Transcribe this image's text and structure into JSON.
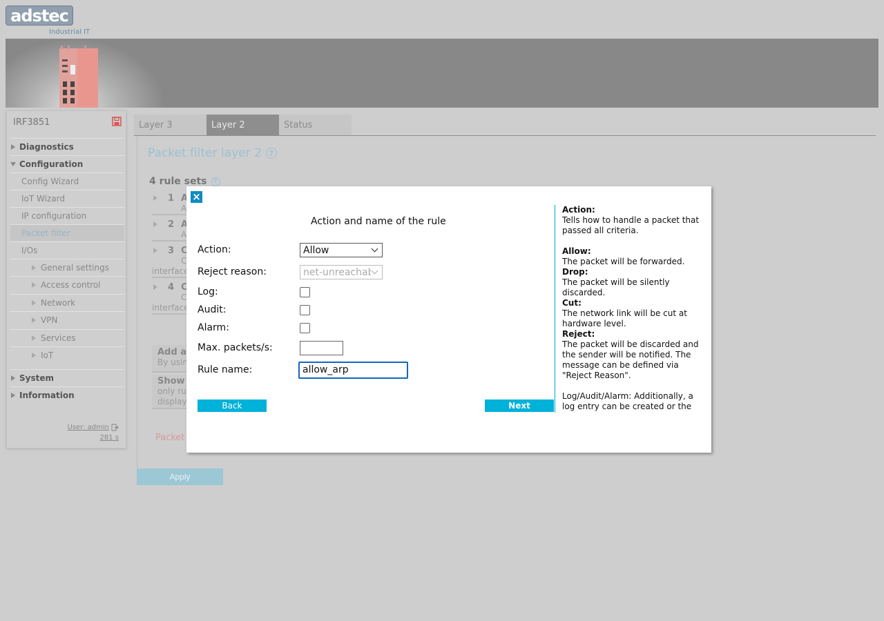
{
  "brand": {
    "logo_text": "adstec",
    "subtitle": "Industrial IT"
  },
  "sidebar": {
    "device_name": "IRF3851",
    "items": [
      {
        "label": "Diagnostics"
      },
      {
        "label": "Configuration"
      },
      {
        "label": "Config Wizard"
      },
      {
        "label": "IoT Wizard"
      },
      {
        "label": "IP configuration"
      },
      {
        "label": "Packet filter"
      },
      {
        "label": "I/Os"
      },
      {
        "label": "General settings"
      },
      {
        "label": "Access control"
      },
      {
        "label": "Network"
      },
      {
        "label": "VPN"
      },
      {
        "label": "Services"
      },
      {
        "label": "IoT"
      },
      {
        "label": "System"
      },
      {
        "label": "Information"
      }
    ],
    "user_link": "User: admin",
    "session_timer": "281 s"
  },
  "tabs": [
    {
      "label": "Layer 3"
    },
    {
      "label": "Layer 2"
    },
    {
      "label": "Status"
    }
  ],
  "main": {
    "title": "Packet filter layer 2",
    "rule_sets_label": "4 rule sets",
    "rules": [
      {
        "num": "1",
        "name": "A",
        "sub": "A",
        "iface": ""
      },
      {
        "num": "2",
        "name": "A",
        "sub": "A",
        "iface": ""
      },
      {
        "num": "3",
        "name": "C",
        "sub": "C",
        "iface": "interface"
      },
      {
        "num": "4",
        "name": "C",
        "sub": "C",
        "iface": "interface"
      }
    ],
    "add_box": {
      "title": "Add a",
      "sub": "By usin"
    },
    "show_box": {
      "title": "Show",
      "line1": "only ru",
      "line2": "display"
    },
    "status_text": "Packet",
    "apply_label": "Apply"
  },
  "modal": {
    "close_glyph": "×",
    "title": "Action and name of the rule",
    "labels": {
      "action": "Action:",
      "reject_reason": "Reject reason:",
      "log": "Log:",
      "audit": "Audit:",
      "alarm": "Alarm:",
      "max_packets": "Max. packets/s:",
      "rule_name": "Rule name:"
    },
    "values": {
      "action": "Allow",
      "reject_reason": "net-unreachable",
      "max_packets": "",
      "rule_name": "allow_arp"
    },
    "buttons": {
      "back": "Back",
      "next": "Next"
    },
    "help": {
      "action_title": "Action:",
      "action_text": "Tells how to handle a packet that passed all criteria.",
      "allow_title": "Allow:",
      "allow_text": "The packet will be forwarded.",
      "drop_title": "Drop:",
      "drop_text": "The packet will be silently discarded.",
      "cut_title": "Cut:",
      "cut_text": "The network link will be cut at hardware level.",
      "reject_title": "Reject:",
      "reject_text": "The packet will be discarded and the sender will be notified. The message can be defined via \"Reject Reason\".",
      "log_text": "Log/Audit/Alarm: Additionally, a log entry can be created or the"
    }
  },
  "colors": {
    "accent": "#00b1d9",
    "close_button": "#0f8bc2",
    "title_blue": "#9cc0d4",
    "background": "#cecece"
  }
}
